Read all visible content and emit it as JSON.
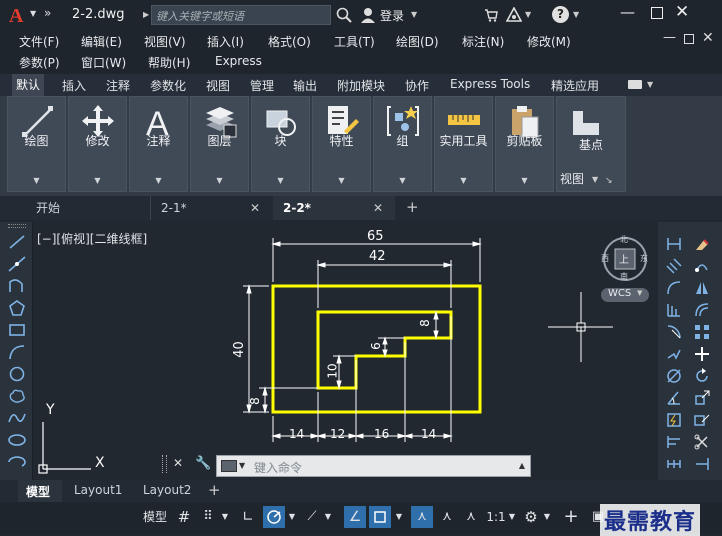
{
  "titlebar": {
    "filename": "2-2.dwg",
    "search_placeholder": "键入关键字或短语",
    "login_label": "登录"
  },
  "menus": {
    "row1": [
      "文件(F)",
      "编辑(E)",
      "视图(V)",
      "插入(I)",
      "格式(O)",
      "工具(T)",
      "绘图(D)",
      "标注(N)",
      "修改(M)"
    ],
    "row2": [
      "参数(P)",
      "窗口(W)",
      "帮助(H)",
      "Express"
    ]
  },
  "ribbon_tabs": [
    "默认",
    "插入",
    "注释",
    "参数化",
    "视图",
    "管理",
    "输出",
    "附加模块",
    "协作",
    "Express Tools",
    "精选应用"
  ],
  "ribbon_panels": [
    "绘图",
    "修改",
    "注释",
    "图层",
    "块",
    "特性",
    "组",
    "实用工具",
    "剪贴板",
    "基点"
  ],
  "view_label": "视图",
  "doc_tabs": [
    "开始",
    "2-1*",
    "2-2*"
  ],
  "viewport_label": "[−][俯视][二维线框]",
  "viewcube": {
    "top": "上",
    "north": "北",
    "south": "南",
    "east": "东",
    "west": "西",
    "wcs": "WCS"
  },
  "dimensions": {
    "overall_width": "65",
    "inner_width": "42",
    "height": "40",
    "left_8": "8",
    "step_8": "8",
    "step_6": "6",
    "step_10": "10",
    "seg1": "14",
    "seg2": "12",
    "seg3": "16",
    "seg4": "14"
  },
  "ucs": {
    "x": "X",
    "y": "Y"
  },
  "command": {
    "placeholder": "键入命令"
  },
  "layout_tabs": [
    "模型",
    "Layout1",
    "Layout2"
  ],
  "status": {
    "model_label": "模型",
    "scale": "1:1"
  },
  "watermark": "最需教育",
  "colors": {
    "accent_yellow": "#ffff00",
    "app_red": "#e23c2c"
  }
}
